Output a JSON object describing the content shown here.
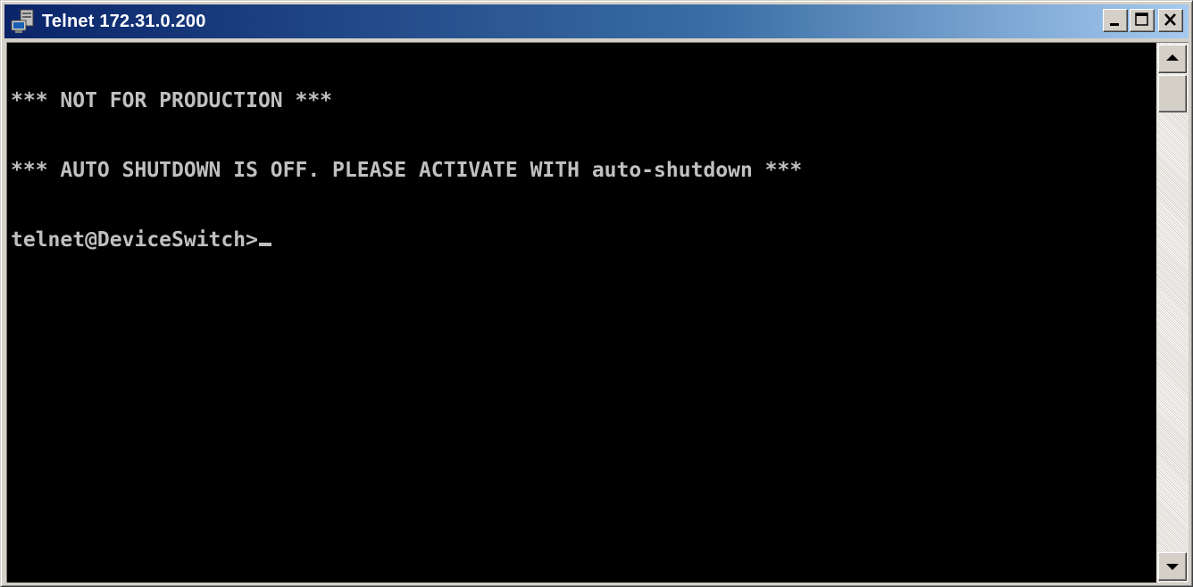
{
  "window": {
    "title": "Telnet 172.31.0.200",
    "icon": "telnet-terminal-icon"
  },
  "caption_buttons": {
    "minimize_icon": "minimize-icon",
    "maximize_icon": "maximize-icon",
    "close_icon": "close-icon"
  },
  "console": {
    "lines": [
      "*** NOT FOR PRODUCTION ***",
      "*** AUTO SHUTDOWN IS OFF. PLEASE ACTIVATE WITH auto-shutdown ***"
    ],
    "prompt": "telnet@DeviceSwitch>"
  },
  "scrollbar": {
    "up_icon": "scroll-up-arrow-icon",
    "down_icon": "scroll-down-arrow-icon"
  },
  "colors": {
    "console_background": "#000000",
    "console_text": "#c0c0c0",
    "titlebar_active": "#0a246a"
  }
}
